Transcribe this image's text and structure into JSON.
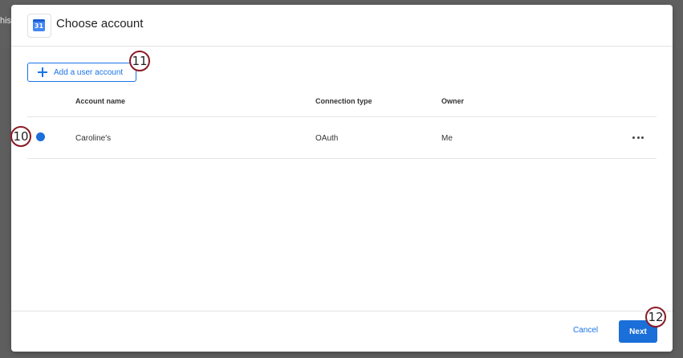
{
  "background": {
    "partial_text": "his"
  },
  "dialog": {
    "title": "Choose account",
    "icon": "google-calendar-icon",
    "calendar_icon_text": "31",
    "add_button_label": "Add a user account",
    "table": {
      "headers": {
        "account_name": "Account name",
        "connection_type": "Connection type",
        "owner": "Owner"
      },
      "rows": [
        {
          "selected": true,
          "account_name": "Caroline's",
          "connection_type": "OAuth",
          "owner": "Me"
        }
      ]
    },
    "cancel_label": "Cancel",
    "next_label": "Next"
  },
  "callouts": {
    "add_account": "11",
    "radio": "10",
    "next": "12"
  },
  "colors": {
    "accent": "#1a6fd8",
    "callout_border": "#8b1a24"
  }
}
